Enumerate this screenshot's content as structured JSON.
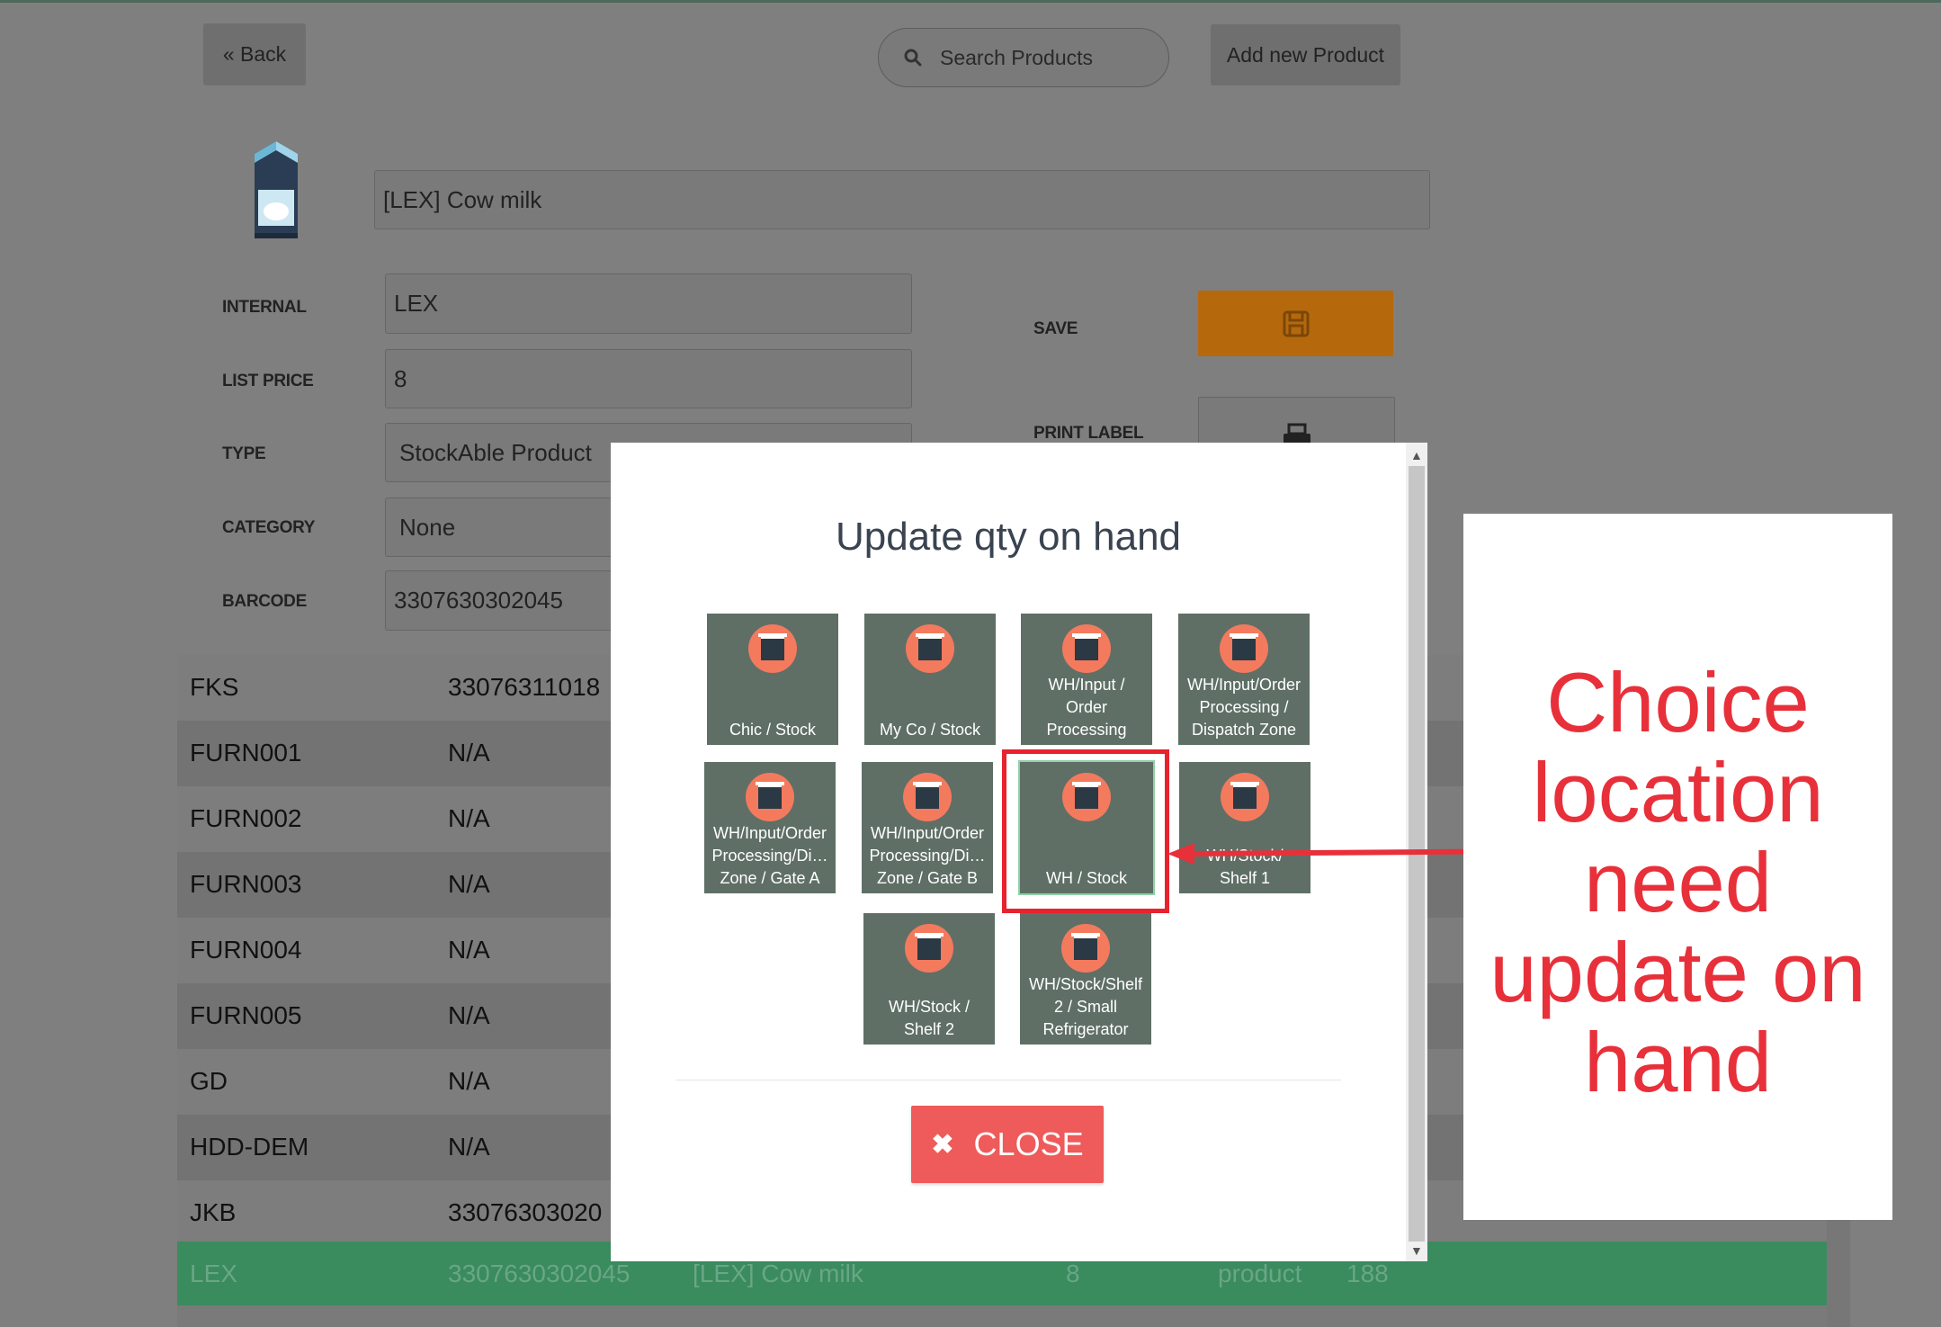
{
  "toolbar": {
    "back_label": "« Back",
    "search_placeholder": "Search Products",
    "add_label": "Add new Product"
  },
  "product": {
    "name": "[LEX] Cow milk",
    "fields": {
      "internal_label": "INTERNAL",
      "internal_value": "LEX",
      "list_price_label": "LIST PRICE",
      "list_price_value": "8",
      "type_label": "TYPE",
      "type_value": "StockAble Product",
      "category_label": "CATEGORY",
      "category_value": "None",
      "barcode_label": "BARCODE",
      "barcode_value": "3307630302045"
    },
    "save_label": "SAVE",
    "print_label": "PRINT LABEL"
  },
  "table": {
    "rows": [
      {
        "code": "FKS",
        "barcode": "33076311018"
      },
      {
        "code": "FURN001",
        "barcode": "N/A"
      },
      {
        "code": "FURN002",
        "barcode": "N/A"
      },
      {
        "code": "FURN003",
        "barcode": "N/A"
      },
      {
        "code": "FURN004",
        "barcode": "N/A"
      },
      {
        "code": "FURN005",
        "barcode": "N/A"
      },
      {
        "code": "GD",
        "barcode": "N/A"
      },
      {
        "code": "HDD-DEM",
        "barcode": "N/A"
      },
      {
        "code": "JKB",
        "barcode": "33076303020"
      }
    ],
    "selected": {
      "code": "LEX",
      "barcode": "3307630302045",
      "name": "[LEX] Cow milk",
      "price": "8",
      "type": "product",
      "qty": "188"
    }
  },
  "modal": {
    "title": "Update qty on hand",
    "close_label": "CLOSE",
    "locations": [
      "Chic / Stock",
      "My Co / Stock",
      "WH/Input /\nOrder\nProcessing",
      "WH/Input/Order\nProcessing /\nDispatch Zone",
      "WH/Input/Order\nProcessing/Di…\nZone / Gate A",
      "WH/Input/Order\nProcessing/Di…\nZone / Gate B",
      "WH / Stock",
      "WH/Stock/\nShelf 1",
      "WH/Stock /\nShelf 2",
      "WH/Stock/Shelf\n2 / Small\nRefrigerator"
    ],
    "selected_location": "WH / Stock"
  },
  "callout": {
    "text": "Choice location need update on hand",
    "color": "#e8303a"
  }
}
